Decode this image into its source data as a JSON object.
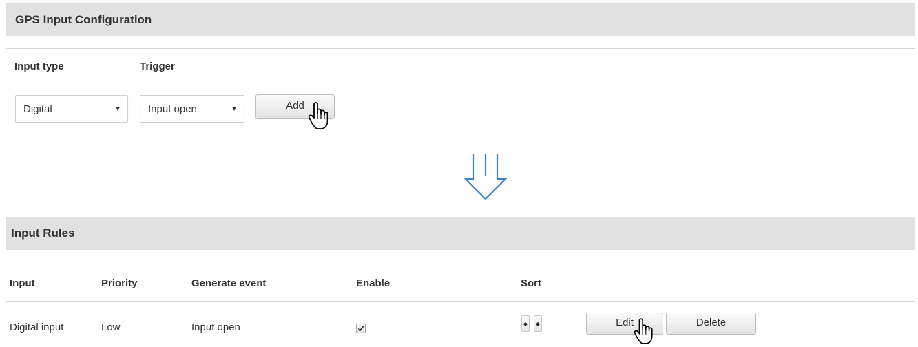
{
  "gps_config": {
    "title": "GPS Input Configuration",
    "columns": {
      "input_type": "Input type",
      "trigger": "Trigger"
    },
    "input_type_select": {
      "value": "Digital"
    },
    "trigger_select": {
      "value": "Input open"
    },
    "add_label": "Add"
  },
  "arrow_icon": "double-down-arrow-icon",
  "arrow_color": "#3a7fd0",
  "input_rules": {
    "title": "Input Rules",
    "columns": {
      "input": "Input",
      "priority": "Priority",
      "generate_event": "Generate event",
      "enable": "Enable",
      "sort": "Sort"
    },
    "rows": [
      {
        "input": "Digital input",
        "priority": "Low",
        "generate_event": "Input open",
        "enabled": true,
        "edit_label": "Edit",
        "delete_label": "Delete"
      }
    ]
  }
}
